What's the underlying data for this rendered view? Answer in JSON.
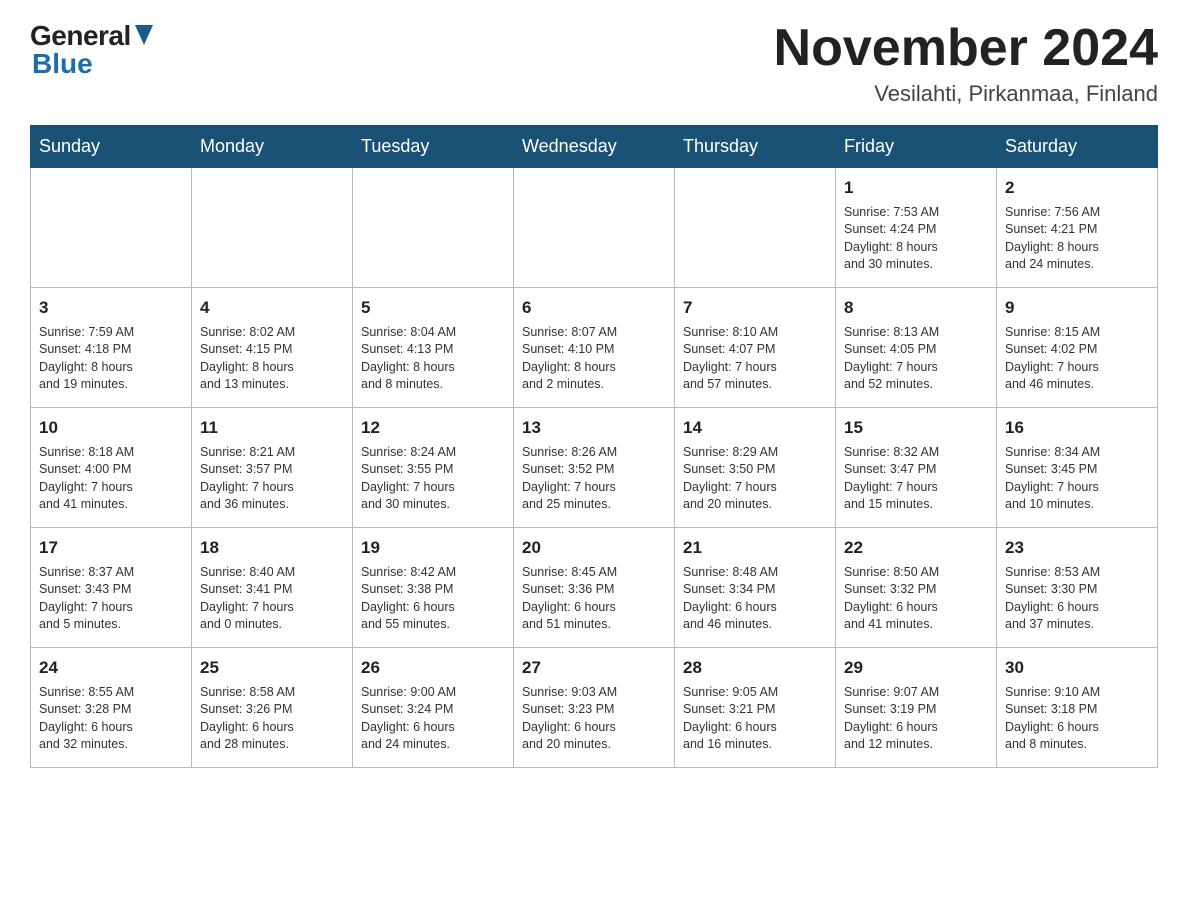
{
  "header": {
    "logo": {
      "general": "General",
      "blue": "Blue"
    },
    "title": "November 2024",
    "location": "Vesilahti, Pirkanmaa, Finland"
  },
  "weekdays": [
    "Sunday",
    "Monday",
    "Tuesday",
    "Wednesday",
    "Thursday",
    "Friday",
    "Saturday"
  ],
  "weeks": [
    [
      {
        "day": "",
        "info": ""
      },
      {
        "day": "",
        "info": ""
      },
      {
        "day": "",
        "info": ""
      },
      {
        "day": "",
        "info": ""
      },
      {
        "day": "",
        "info": ""
      },
      {
        "day": "1",
        "info": "Sunrise: 7:53 AM\nSunset: 4:24 PM\nDaylight: 8 hours\nand 30 minutes."
      },
      {
        "day": "2",
        "info": "Sunrise: 7:56 AM\nSunset: 4:21 PM\nDaylight: 8 hours\nand 24 minutes."
      }
    ],
    [
      {
        "day": "3",
        "info": "Sunrise: 7:59 AM\nSunset: 4:18 PM\nDaylight: 8 hours\nand 19 minutes."
      },
      {
        "day": "4",
        "info": "Sunrise: 8:02 AM\nSunset: 4:15 PM\nDaylight: 8 hours\nand 13 minutes."
      },
      {
        "day": "5",
        "info": "Sunrise: 8:04 AM\nSunset: 4:13 PM\nDaylight: 8 hours\nand 8 minutes."
      },
      {
        "day": "6",
        "info": "Sunrise: 8:07 AM\nSunset: 4:10 PM\nDaylight: 8 hours\nand 2 minutes."
      },
      {
        "day": "7",
        "info": "Sunrise: 8:10 AM\nSunset: 4:07 PM\nDaylight: 7 hours\nand 57 minutes."
      },
      {
        "day": "8",
        "info": "Sunrise: 8:13 AM\nSunset: 4:05 PM\nDaylight: 7 hours\nand 52 minutes."
      },
      {
        "day": "9",
        "info": "Sunrise: 8:15 AM\nSunset: 4:02 PM\nDaylight: 7 hours\nand 46 minutes."
      }
    ],
    [
      {
        "day": "10",
        "info": "Sunrise: 8:18 AM\nSunset: 4:00 PM\nDaylight: 7 hours\nand 41 minutes."
      },
      {
        "day": "11",
        "info": "Sunrise: 8:21 AM\nSunset: 3:57 PM\nDaylight: 7 hours\nand 36 minutes."
      },
      {
        "day": "12",
        "info": "Sunrise: 8:24 AM\nSunset: 3:55 PM\nDaylight: 7 hours\nand 30 minutes."
      },
      {
        "day": "13",
        "info": "Sunrise: 8:26 AM\nSunset: 3:52 PM\nDaylight: 7 hours\nand 25 minutes."
      },
      {
        "day": "14",
        "info": "Sunrise: 8:29 AM\nSunset: 3:50 PM\nDaylight: 7 hours\nand 20 minutes."
      },
      {
        "day": "15",
        "info": "Sunrise: 8:32 AM\nSunset: 3:47 PM\nDaylight: 7 hours\nand 15 minutes."
      },
      {
        "day": "16",
        "info": "Sunrise: 8:34 AM\nSunset: 3:45 PM\nDaylight: 7 hours\nand 10 minutes."
      }
    ],
    [
      {
        "day": "17",
        "info": "Sunrise: 8:37 AM\nSunset: 3:43 PM\nDaylight: 7 hours\nand 5 minutes."
      },
      {
        "day": "18",
        "info": "Sunrise: 8:40 AM\nSunset: 3:41 PM\nDaylight: 7 hours\nand 0 minutes."
      },
      {
        "day": "19",
        "info": "Sunrise: 8:42 AM\nSunset: 3:38 PM\nDaylight: 6 hours\nand 55 minutes."
      },
      {
        "day": "20",
        "info": "Sunrise: 8:45 AM\nSunset: 3:36 PM\nDaylight: 6 hours\nand 51 minutes."
      },
      {
        "day": "21",
        "info": "Sunrise: 8:48 AM\nSunset: 3:34 PM\nDaylight: 6 hours\nand 46 minutes."
      },
      {
        "day": "22",
        "info": "Sunrise: 8:50 AM\nSunset: 3:32 PM\nDaylight: 6 hours\nand 41 minutes."
      },
      {
        "day": "23",
        "info": "Sunrise: 8:53 AM\nSunset: 3:30 PM\nDaylight: 6 hours\nand 37 minutes."
      }
    ],
    [
      {
        "day": "24",
        "info": "Sunrise: 8:55 AM\nSunset: 3:28 PM\nDaylight: 6 hours\nand 32 minutes."
      },
      {
        "day": "25",
        "info": "Sunrise: 8:58 AM\nSunset: 3:26 PM\nDaylight: 6 hours\nand 28 minutes."
      },
      {
        "day": "26",
        "info": "Sunrise: 9:00 AM\nSunset: 3:24 PM\nDaylight: 6 hours\nand 24 minutes."
      },
      {
        "day": "27",
        "info": "Sunrise: 9:03 AM\nSunset: 3:23 PM\nDaylight: 6 hours\nand 20 minutes."
      },
      {
        "day": "28",
        "info": "Sunrise: 9:05 AM\nSunset: 3:21 PM\nDaylight: 6 hours\nand 16 minutes."
      },
      {
        "day": "29",
        "info": "Sunrise: 9:07 AM\nSunset: 3:19 PM\nDaylight: 6 hours\nand 12 minutes."
      },
      {
        "day": "30",
        "info": "Sunrise: 9:10 AM\nSunset: 3:18 PM\nDaylight: 6 hours\nand 8 minutes."
      }
    ]
  ]
}
